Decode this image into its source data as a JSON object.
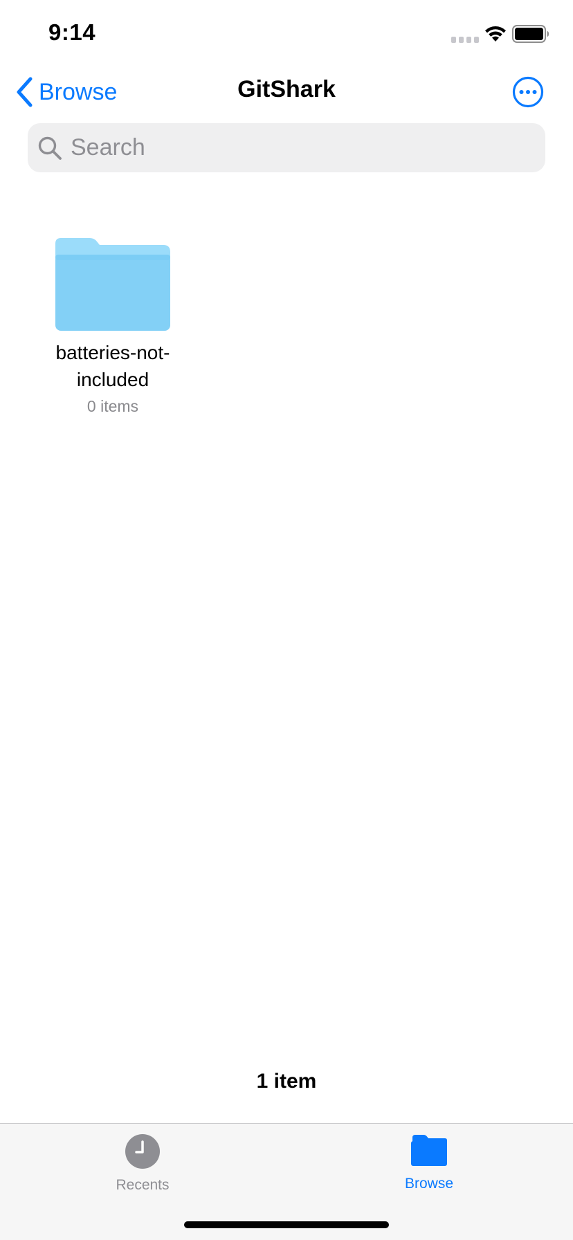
{
  "status_bar": {
    "time": "9:14",
    "signal_icon": "signal-dots-icon",
    "wifi_icon": "wifi-icon",
    "battery_icon": "battery-icon"
  },
  "nav": {
    "back_label": "Browse",
    "back_icon": "chevron-left-icon",
    "title": "GitShark",
    "more_icon": "ellipsis-circle-icon"
  },
  "search": {
    "placeholder": "Search",
    "value": "",
    "icon": "magnifying-glass-icon"
  },
  "folders": [
    {
      "name": "batteries-not-included",
      "name_line1": "batteries-not-",
      "name_line2": "included",
      "count": "0 items",
      "icon": "folder-icon"
    }
  ],
  "footer": {
    "items_count": "1 item"
  },
  "tab_bar": {
    "tabs": [
      {
        "label": "Recents",
        "icon": "clock-icon",
        "selected": false
      },
      {
        "label": "Browse",
        "icon": "folder-fill-icon",
        "selected": true
      }
    ]
  },
  "colors": {
    "accent": "#0a7aff",
    "folder_light": "#9bdcfa",
    "folder_body": "#7ccdf5",
    "secondary_text": "#8e8e93",
    "search_bg": "#efeff0",
    "tab_bar_bg": "#f6f6f6"
  }
}
